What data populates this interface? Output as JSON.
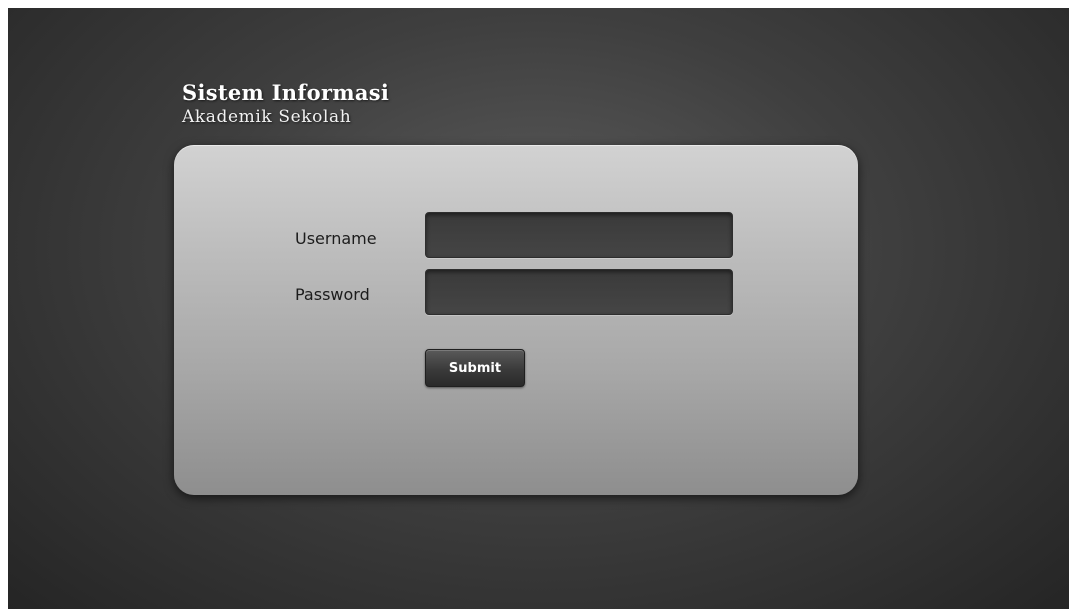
{
  "header": {
    "title_line1": "Sistem Informasi",
    "title_line2": "Akademik Sekolah"
  },
  "login_form": {
    "username_label": "Username",
    "username_value": "",
    "password_label": "Password",
    "password_value": "",
    "submit_label": "Submit"
  },
  "colors": {
    "background_center": "#5c5c5c",
    "background_edge": "#252525",
    "panel_top": "#d2d2d2",
    "panel_bottom": "#8e8e8e",
    "input_fill": "#3f3f3f",
    "button_fill": "#3a3a3a",
    "label_text": "#1c1c1c",
    "title_text": "#ffffff"
  }
}
